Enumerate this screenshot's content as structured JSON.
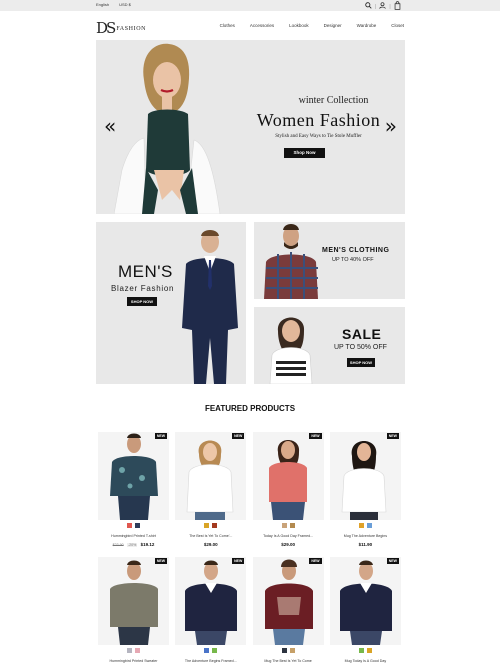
{
  "topbar": {
    "language": "English",
    "currency": "USD $",
    "separator": "|"
  },
  "header": {
    "logo_mono": "DS",
    "logo_word": "FASHION",
    "nav": [
      "Clothes",
      "Accessories",
      "Lookbook",
      "Designer",
      "Wardrobe",
      "Closet"
    ]
  },
  "hero": {
    "subtitle": "winter Collection",
    "title": "Women Fashion",
    "description": "Stylish and Easy Ways to Tie Stole Muffler",
    "button": "Shop Now",
    "prev_glyph": "«",
    "next_glyph": "»"
  },
  "promos": {
    "mens": {
      "title": "MEN'S",
      "subtitle": "Blazer Fashion",
      "button": "SHOP NOW"
    },
    "clothing": {
      "title": "MEN'S CLOTHING",
      "subtitle": "UP TO 40% OFF"
    },
    "sale": {
      "title": "SALE",
      "subtitle": "UP TO 50% OFF",
      "button": "SHOP NOW"
    }
  },
  "featured_title": "FEATURED PRODUCTS",
  "badge": "NEW",
  "products": [
    {
      "name": "Hummingbird Printed T-shirt",
      "old_price": "$23.90",
      "discount": "-20%",
      "price": "$19.12",
      "swatches": [
        "#e0574f",
        "#2e3c5a"
      ],
      "figure": "shirt-print"
    },
    {
      "name": "The Best Is Yet To Come'...",
      "price": "$29.00",
      "swatches": [
        "#d9a426",
        "#a3391f"
      ],
      "figure": "blouse-white"
    },
    {
      "name": "Today Is A Good Day Framed...",
      "price": "$29.00",
      "swatches": [
        "#c9a37a",
        "#b38a4f"
      ],
      "figure": "top-coral"
    },
    {
      "name": "Mug The Adventure Begins",
      "price": "$11.90",
      "swatches": [
        "#e0a22a",
        "#6a9ed8"
      ],
      "figure": "blouse-white2"
    },
    {
      "name": "Hummingbird Printed Sweater",
      "price": "",
      "swatches": [
        "#b5b5c0",
        "#e6a8b3"
      ],
      "figure": "polo-olive"
    },
    {
      "name": "The Adventure Begins Framed...",
      "price": "",
      "swatches": [
        "#4a74c9",
        "#77b84a"
      ],
      "figure": "sweater-navy"
    },
    {
      "name": "Mug The Best Is Yet To Come",
      "price": "",
      "swatches": [
        "#2d3440",
        "#c6a068"
      ],
      "figure": "tee-maroon"
    },
    {
      "name": "Mug Today Is A Good Day",
      "price": "",
      "swatches": [
        "#77b84a",
        "#d9a426"
      ],
      "figure": "sweater-navy2"
    }
  ]
}
